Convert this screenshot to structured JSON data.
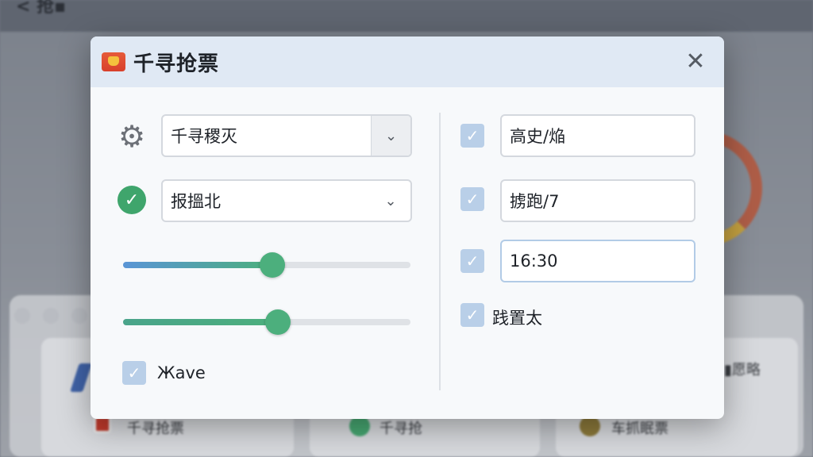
{
  "dialog": {
    "title": "千寻抢票",
    "close_glyph": "✕"
  },
  "left": {
    "select1": {
      "value": "千寻稷灭",
      "chevron": "⌄"
    },
    "select2": {
      "value": "报搵北",
      "chevron": "⌄"
    },
    "slider1": {
      "value_pct": 52
    },
    "slider2": {
      "value_pct": 54
    },
    "save_checkbox": {
      "label": "Жave",
      "checked": true
    }
  },
  "right": {
    "field1": {
      "checked": true,
      "value": "高史/焔"
    },
    "field2": {
      "checked": true,
      "value": "掳跑/7"
    },
    "field3": {
      "checked": true,
      "value": "16:30"
    },
    "option_checkbox": {
      "label": "践置太",
      "checked": true
    }
  },
  "background": {
    "title_fragment": "< 抢▪",
    "label_right": "▮愿略",
    "bottom_items": [
      "千寻抢票",
      "千寻抢",
      "车抓眠票"
    ]
  },
  "colors": {
    "header_bg": "#e0e9f4",
    "accent_green": "#4caf7d",
    "accent_blue": "#5a95d6",
    "checkbox": "#b9cfe8"
  },
  "icons": {
    "app": "ticket-app-icon",
    "gear": "gear-icon",
    "check": "check-circle-icon",
    "close": "close-icon"
  }
}
